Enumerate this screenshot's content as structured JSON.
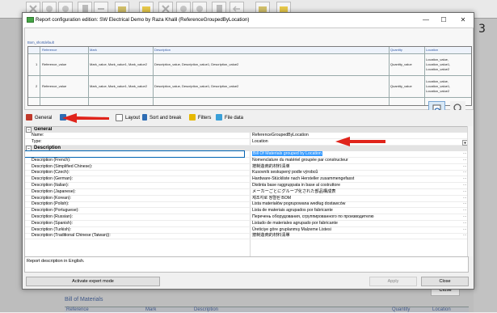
{
  "dialog": {
    "title": "Report configuration edition: SW Electrical Demo by Raza Khalil (ReferenceGroupedByLocation)",
    "controls": {
      "minimize": "—",
      "maximize": "☐",
      "close": "✕"
    }
  },
  "background": {
    "right_number": "3",
    "bottom_title": "Bill of Materials",
    "bottom_headers": [
      "Reference",
      "Mark",
      "Description",
      "Quantity",
      "Location"
    ],
    "close_label": "Close"
  },
  "preview": {
    "caption": "Bom_shortdefault",
    "headers": [
      "Reference",
      "Mark",
      "Description",
      "Quantity",
      "Location"
    ],
    "rows": [
      {
        "index": "1",
        "reference": "Reference_value",
        "mark": "Mark_value, Mark_value1, Mark_value2",
        "description": "Description_value, Description_value1, Description_value2",
        "quantity": "Quantity_value",
        "location": [
          "Location_value,",
          "Location_value1,",
          "Location_value2"
        ]
      },
      {
        "index": "2",
        "reference": "Reference_value",
        "mark": "Mark_value, Mark_value1, Mark_value2",
        "description": "Description_value, Description_value1, Description_value2",
        "quantity": "Quantity_value",
        "location": [
          "Location_value,",
          "Location_value1,",
          "Location_value2"
        ]
      }
    ]
  },
  "tabs": [
    {
      "label": "General",
      "icon": "general-icon",
      "color": "#c0392b"
    },
    {
      "label": "Columns",
      "icon": "columns-icon",
      "color": "#2e6db4"
    },
    {
      "label": "Layout",
      "icon": "layout-icon",
      "color": "#ffffff"
    },
    {
      "label": "Sort and break",
      "icon": "sort-icon",
      "color": "#2e6db4"
    },
    {
      "label": "Filters",
      "icon": "filter-icon",
      "color": "#e6b800"
    },
    {
      "label": "File data",
      "icon": "file-data-icon",
      "color": "#3aa0d8"
    }
  ],
  "properties": {
    "general_section": "General",
    "name_label": "Name:",
    "name_value": "ReferenceGroupedByLocation",
    "type_label": "Type:",
    "type_value": "Location",
    "description_section": "Description",
    "descriptions": [
      {
        "label": "Description (English):",
        "value": "Bill Of Materials grouped by Location"
      },
      {
        "label": "Description (French):",
        "value": "Nomenclature du matériel groupée par constructeur"
      },
      {
        "label": "Description (Simplified Chinese):",
        "value": "按制造商的材料清单"
      },
      {
        "label": "Description (Czech):",
        "value": "Kusovník seskupený podle výrobců"
      },
      {
        "label": "Description (German):",
        "value": "Hardware-Stückliste nach Hersteller zusammengefasst"
      },
      {
        "label": "Description (Italian):",
        "value": "Distinta base raggruppata in base al costruttore"
      },
      {
        "label": "Description (Japanese):",
        "value": "メーカーごとにグループ化された部品構成表"
      },
      {
        "label": "Description (Korean):",
        "value": "제조자로 정렬된 BOM"
      },
      {
        "label": "Description (Polish):",
        "value": "Lista materiałów pogrupowana według dostawców"
      },
      {
        "label": "Description (Portuguese):",
        "value": "Lista de materiais agrupados por fabricante"
      },
      {
        "label": "Description (Russian):",
        "value": "Перечень оборудования, сгруппированного по производителю"
      },
      {
        "label": "Description (Spanish):",
        "value": "Listado de materiales agrupado por fabricante"
      },
      {
        "label": "Description (Turkish):",
        "value": "Üreticiye göre gruplanmış Malzeme Listesi"
      },
      {
        "label": "Description (Traditional Chinese (Taiwan)):",
        "value": "按制造商的材料清單"
      }
    ]
  },
  "description_box": "Report description in English.",
  "buttons": {
    "expert": "Activate expert mode",
    "apply": "Apply",
    "close": "Close"
  },
  "colors": {
    "annotation_arrow": "#e0241b",
    "selection": "#3399ff",
    "link_blue": "#345aa5"
  }
}
